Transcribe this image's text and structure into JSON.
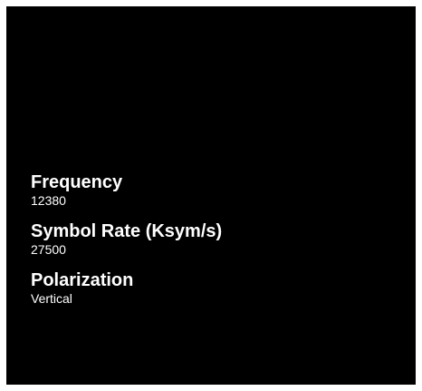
{
  "parameters": [
    {
      "label": "Frequency",
      "value": "12380"
    },
    {
      "label": "Symbol Rate (Ksym/s)",
      "value": "27500"
    },
    {
      "label": "Polarization",
      "value": "Vertical"
    }
  ],
  "colors": {
    "background": "#000000",
    "frame": "#ffffff",
    "text": "#ffffff"
  }
}
